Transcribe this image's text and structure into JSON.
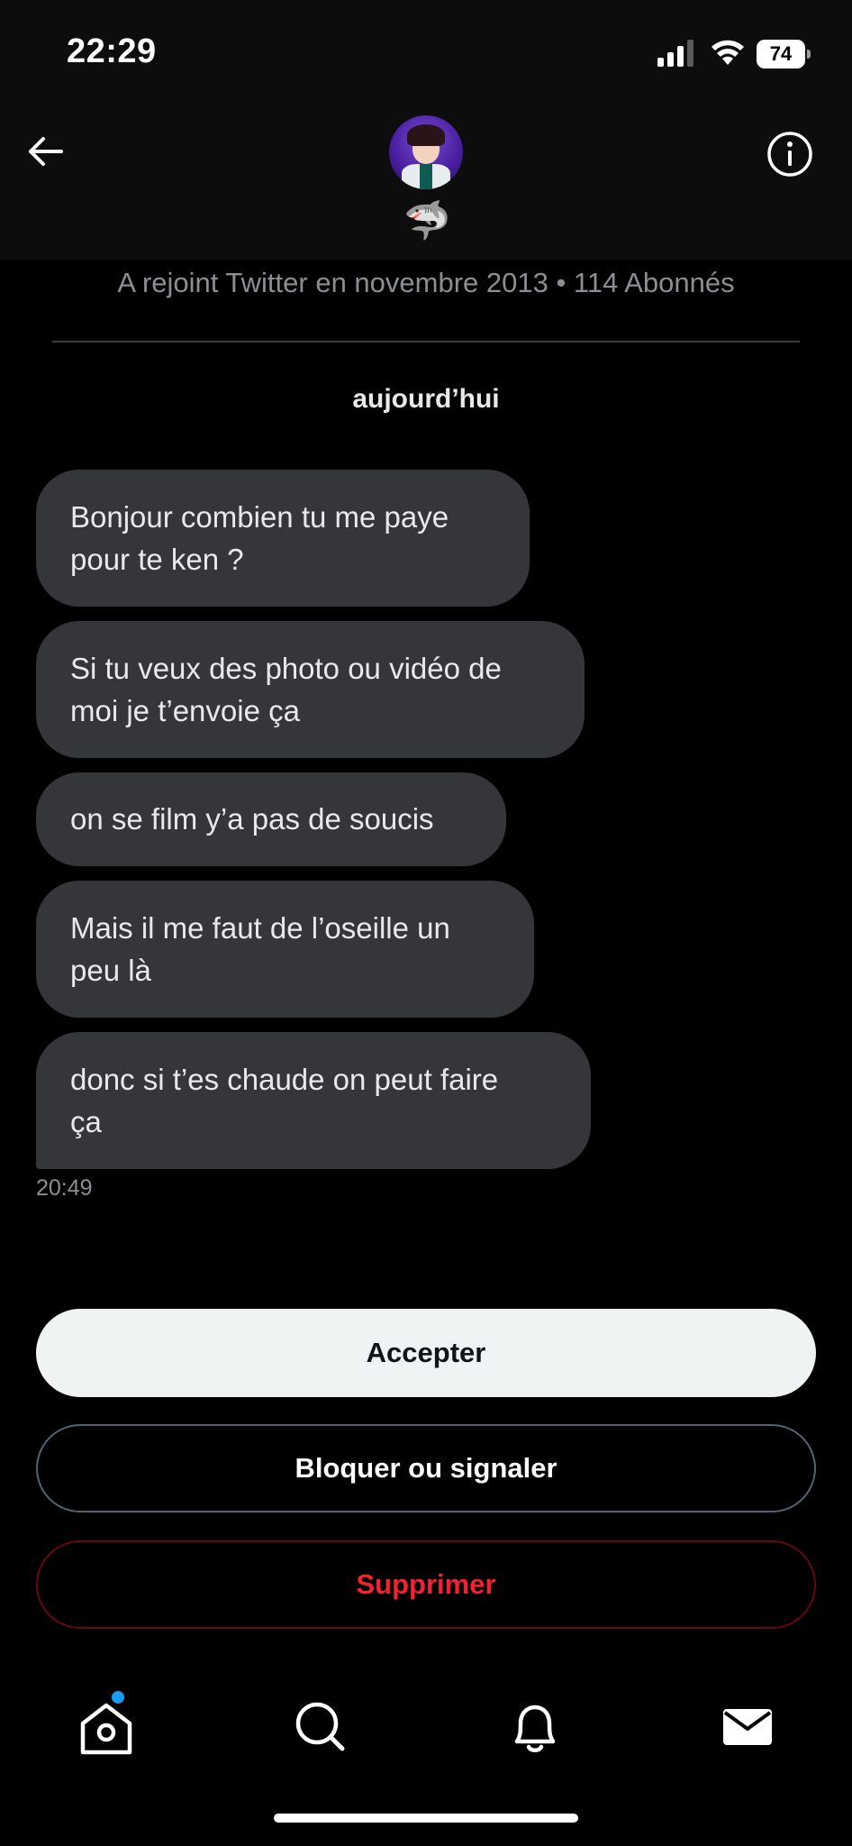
{
  "status_bar": {
    "time": "22:29",
    "battery": "74",
    "icons": [
      "signal-icon",
      "wifi-icon",
      "battery-icon"
    ]
  },
  "header": {
    "emoji": "🦈",
    "icons": [
      "back-arrow-icon",
      "info-icon"
    ]
  },
  "profile": {
    "joined_text": "A rejoint Twitter en novembre 2013 • 114 Abonnés"
  },
  "conversation": {
    "day_label": "aujourd’hui",
    "messages": [
      {
        "lines": [
          "Bonjour combien tu me paye",
          "pour te ken ?"
        ]
      },
      {
        "lines": [
          "Si tu veux des photo ou vidéo de",
          "moi je t’envoie ça"
        ]
      },
      {
        "lines": [
          "on se film y’a pas de soucis"
        ]
      },
      {
        "lines": [
          "Mais il me faut de l’oseille un",
          "peu là"
        ]
      },
      {
        "lines": [
          "donc si t’es chaude on peut faire",
          "ça"
        ]
      }
    ],
    "last_time": "20:49"
  },
  "actions": {
    "accept_label": "Accepter",
    "block_label": "Bloquer ou signaler",
    "delete_label": "Supprimer"
  },
  "bottom_nav": {
    "items": [
      "home-icon",
      "search-icon",
      "notifications-bell-icon",
      "messages-envelope-icon"
    ],
    "accent_color": "#1d9bf0"
  },
  "colors": {
    "bubble": "#343639",
    "delete_text": "#f4212e",
    "muted_text": "#8b8f94"
  }
}
